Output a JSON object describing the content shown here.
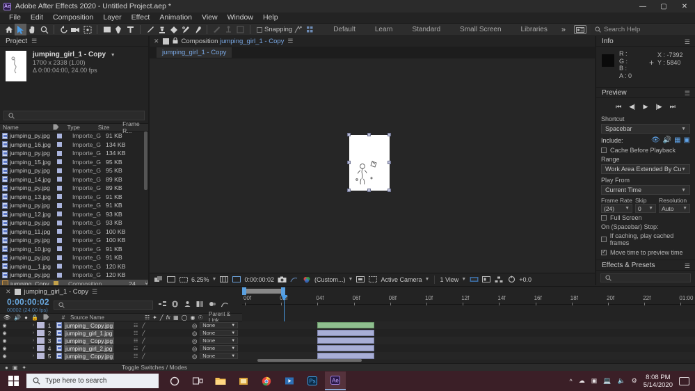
{
  "window": {
    "title": "Adobe After Effects 2020 - Untitled Project.aep *",
    "logo": "ae-logo",
    "minimize": "—",
    "maximize": "▢",
    "close": "✕"
  },
  "menu": {
    "items": [
      "File",
      "Edit",
      "Composition",
      "Layer",
      "Effect",
      "Animation",
      "View",
      "Window",
      "Help"
    ]
  },
  "toolbar": {
    "tools": [
      {
        "name": "home-icon"
      },
      {
        "name": "selection-tool-icon"
      },
      {
        "name": "hand-tool-icon"
      },
      {
        "name": "zoom-tool-icon"
      },
      {
        "name": "rotation-tool-icon"
      },
      {
        "name": "camera-tool-icon"
      },
      {
        "name": "pan-behind-tool-icon"
      },
      {
        "name": "shape-tool-icon"
      },
      {
        "name": "pen-tool-icon"
      },
      {
        "name": "type-tool-icon"
      },
      {
        "name": "brush-tool-icon"
      },
      {
        "name": "clone-stamp-tool-icon"
      },
      {
        "name": "eraser-tool-icon"
      },
      {
        "name": "roto-brush-tool-icon"
      },
      {
        "name": "puppet-pin-tool-icon"
      }
    ],
    "snapping_label": "Snapping",
    "snapping_checked": false,
    "workspaces": [
      "Default",
      "Learn",
      "Standard",
      "Small Screen",
      "Libraries"
    ],
    "overflow": "»",
    "search_placeholder": "Search Help"
  },
  "project": {
    "panel_title": "Project",
    "item_name": "jumping_girl_1 - Copy",
    "item_dims": "1700 x 2338 (1.00)",
    "item_duration": "Δ 0:00:04:00, 24.00 fps",
    "search_placeholder": "",
    "columns": [
      "Name",
      "Type",
      "Size",
      "Frame R..."
    ],
    "rows": [
      {
        "name": "jumping_Copy",
        "type": "Composition",
        "size": "",
        "frames": "24",
        "kind": "comp",
        "selected": true
      },
      {
        "name": "jumping_py.jpg",
        "type": "Importe_G",
        "size": "120 KB",
        "frames": "",
        "kind": "file"
      },
      {
        "name": "jumping__1.jpg",
        "type": "Importe_G",
        "size": "120 KB",
        "frames": "",
        "kind": "file"
      },
      {
        "name": "jumping_py.jpg",
        "type": "Importe_G",
        "size": "91 KB",
        "frames": "",
        "kind": "file"
      },
      {
        "name": "jumping_10.jpg",
        "type": "Importe_G",
        "size": "91 KB",
        "frames": "",
        "kind": "file"
      },
      {
        "name": "jumping_py.jpg",
        "type": "Importe_G",
        "size": "100 KB",
        "frames": "",
        "kind": "file"
      },
      {
        "name": "jumping_11.jpg",
        "type": "Importe_G",
        "size": "100 KB",
        "frames": "",
        "kind": "file"
      },
      {
        "name": "jumping_py.jpg",
        "type": "Importe_G",
        "size": "93 KB",
        "frames": "",
        "kind": "file"
      },
      {
        "name": "jumping_12.jpg",
        "type": "Importe_G",
        "size": "93 KB",
        "frames": "",
        "kind": "file"
      },
      {
        "name": "jumping_py.jpg",
        "type": "Importe_G",
        "size": "91 KB",
        "frames": "",
        "kind": "file"
      },
      {
        "name": "jumping_13.jpg",
        "type": "Importe_G",
        "size": "91 KB",
        "frames": "",
        "kind": "file"
      },
      {
        "name": "jumping_py.jpg",
        "type": "Importe_G",
        "size": "89 KB",
        "frames": "",
        "kind": "file"
      },
      {
        "name": "jumping_14.jpg",
        "type": "Importe_G",
        "size": "89 KB",
        "frames": "",
        "kind": "file"
      },
      {
        "name": "jumping_py.jpg",
        "type": "Importe_G",
        "size": "95 KB",
        "frames": "",
        "kind": "file"
      },
      {
        "name": "jumping_15.jpg",
        "type": "Importe_G",
        "size": "95 KB",
        "frames": "",
        "kind": "file"
      },
      {
        "name": "jumping_py.jpg",
        "type": "Importe_G",
        "size": "134 KB",
        "frames": "",
        "kind": "file"
      },
      {
        "name": "jumping_16.jpg",
        "type": "Importe_G",
        "size": "134 KB",
        "frames": "",
        "kind": "file"
      },
      {
        "name": "jumping_py.jpg",
        "type": "Importe_G",
        "size": "91 KB",
        "frames": "",
        "kind": "file"
      }
    ]
  },
  "composition": {
    "tab_prefix": "Composition",
    "tab_name": "jumping_girl_1 - Copy",
    "breadcrumb": "jumping_girl_1 - Copy",
    "zoom": "6.25%",
    "time": "0:00:00:02",
    "resolution": "(Custom...)",
    "camera": "Active Camera",
    "views": "1 View",
    "exposure": "+0.0"
  },
  "info": {
    "title": "Info",
    "r": "R :",
    "g": "G :",
    "b": "B :",
    "a": "A : 0",
    "x": "X : -7392",
    "y": "Y : 5840"
  },
  "preview": {
    "title": "Preview",
    "shortcut_label": "Shortcut",
    "shortcut_value": "Spacebar",
    "include_label": "Include:",
    "cache_label": "Cache Before Playback",
    "cache_checked": false,
    "range_label": "Range",
    "range_value": "Work Area Extended By Current...",
    "play_from_label": "Play From",
    "play_from_value": "Current Time",
    "frame_rate_label": "Frame Rate",
    "frame_rate_value": "(24)",
    "skip_label": "Skip",
    "skip_value": "0",
    "resolution_label": "Resolution",
    "resolution_value": "Auto",
    "fullscreen_label": "Full Screen",
    "fullscreen_checked": false,
    "onstop_label": "On (Spacebar) Stop:",
    "cached_label": "If caching, play cached frames",
    "cached_checked": false,
    "movetime_label": "Move time to preview time",
    "movetime_checked": true
  },
  "effects": {
    "title": "Effects & Presets",
    "search_placeholder": ""
  },
  "timeline": {
    "tab_name": "jumping_girl_1 - Copy",
    "timecode": "0:00:00:02",
    "timecode_sub": "00002 (24.00 fps)",
    "search_placeholder": "",
    "columns": {
      "num": "#",
      "source_name": "Source Name",
      "parent": "Parent & Link"
    },
    "ruler_ticks": [
      "00f",
      "02f",
      "04f",
      "06f",
      "08f",
      "10f",
      "12f",
      "14f",
      "16f",
      "18f",
      "20f",
      "22f",
      "01:00"
    ],
    "layers": [
      {
        "num": "1",
        "name": "jumping_ Copy.jpg",
        "parent": "None"
      },
      {
        "num": "2",
        "name": "jumping_girl_1.jpg",
        "parent": "None"
      },
      {
        "num": "3",
        "name": "jumping_ Copy.jpg",
        "parent": "None"
      },
      {
        "num": "4",
        "name": "jumping_girl_2.jpg",
        "parent": "None"
      },
      {
        "num": "5",
        "name": "jumping_ Copy.jpg",
        "parent": "None"
      }
    ],
    "footer_toggle": "Toggle Switches / Modes"
  },
  "taskbar": {
    "search_placeholder": "Type here to search",
    "time": "8:08 PM",
    "date": "5/14/2020",
    "apps": [
      "cortana-icon",
      "task-view-icon",
      "file-explorer-icon",
      "store-icon",
      "chrome-icon",
      "media-icon",
      "photoshop-icon",
      "after-effects-icon"
    ]
  },
  "colors": {
    "accent": "#4a9de8",
    "panel": "#232323",
    "taskbar": "#3b1f27"
  }
}
